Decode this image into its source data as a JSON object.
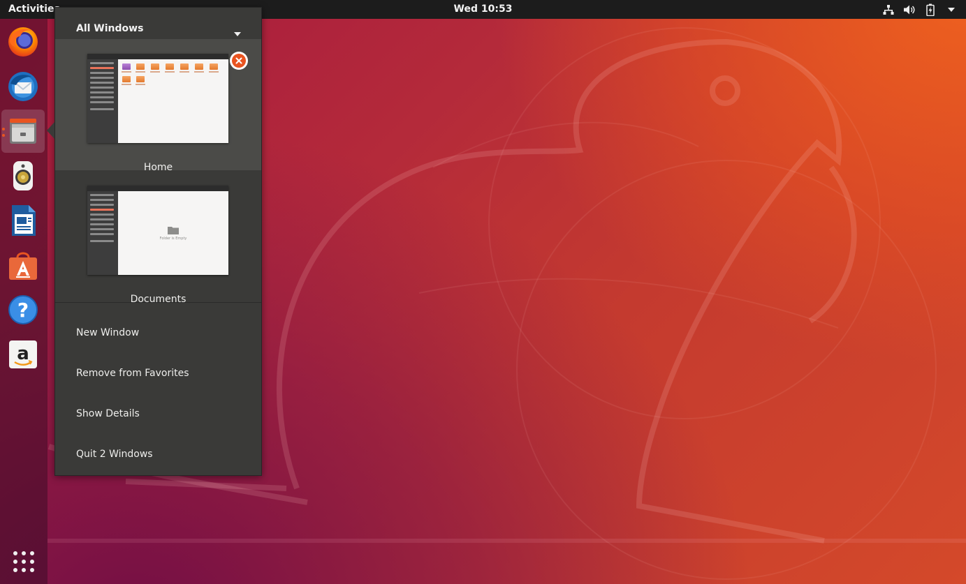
{
  "top_bar": {
    "activities_label": "Activities",
    "clock": "Wed 10:53",
    "tray_icons": [
      "network-icon",
      "volume-icon",
      "battery-icon",
      "system-menu-chevron-icon"
    ]
  },
  "dock": {
    "items": [
      {
        "name": "firefox",
        "icon": "firefox-icon"
      },
      {
        "name": "thunderbird",
        "icon": "thunderbird-icon"
      },
      {
        "name": "files",
        "icon": "files-icon",
        "active": true,
        "running_windows": 2
      },
      {
        "name": "rhythmbox",
        "icon": "rhythmbox-icon"
      },
      {
        "name": "libreoffice-writer",
        "icon": "writer-icon"
      },
      {
        "name": "ubuntu-software",
        "icon": "software-icon"
      },
      {
        "name": "help",
        "icon": "help-icon"
      },
      {
        "name": "amazon",
        "icon": "amazon-icon"
      }
    ],
    "show_apps_icon": "grid-icon"
  },
  "app_menu": {
    "header": "All Windows",
    "windows": [
      {
        "title": "Home",
        "thumb_main_text": ""
      },
      {
        "title": "Documents",
        "thumb_main_text": "Folder is Empty"
      }
    ],
    "items": [
      {
        "label": "New Window"
      },
      {
        "label": "Remove from Favorites"
      },
      {
        "label": "Show Details"
      },
      {
        "label": "Quit 2 Windows"
      }
    ]
  },
  "colors": {
    "accent": "#e95420",
    "panel": "#1c1c1c",
    "menu_bg": "#3a3a38",
    "menu_hover": "#4b4b48"
  }
}
